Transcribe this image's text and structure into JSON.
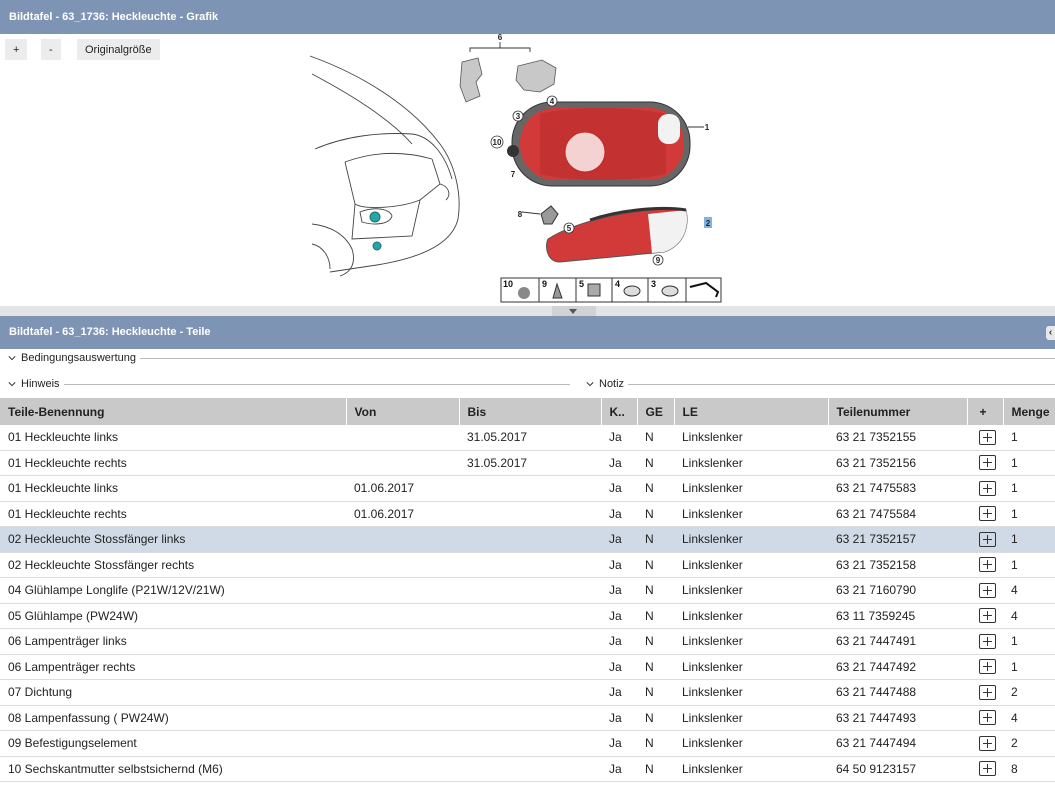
{
  "graphic_panel": {
    "title": "Bildtafel - 63_1736: Heckleuchte - Grafik",
    "zoom_in": "+",
    "zoom_out": "-",
    "original_size": "Originalgröße",
    "callouts": [
      "6",
      "4",
      "3",
      "1",
      "10",
      "7",
      "8",
      "5",
      "2",
      "9"
    ],
    "legend": [
      "10",
      "9",
      "5",
      "4",
      "3"
    ]
  },
  "parts_panel": {
    "title": "Bildtafel - 63_1736: Heckleuchte - Teile",
    "collapse_icon": "chevron-left-icon",
    "sections": {
      "bedingungsauswertung": "Bedingungsauswertung",
      "hinweis": "Hinweis",
      "notiz": "Notiz"
    },
    "columns": {
      "name": "Teile-Benennung",
      "von": "Von",
      "bis": "Bis",
      "k": "K..",
      "ge": "GE",
      "le": "LE",
      "teilenummer": "Teilenummer",
      "add": "+",
      "menge": "Menge"
    },
    "rows": [
      {
        "name": "01 Heckleuchte links",
        "von": "",
        "bis": "31.05.2017",
        "k": "Ja",
        "ge": "N",
        "le": "Linkslenker",
        "nr": "63 21 7352155",
        "menge": "1"
      },
      {
        "name": "01 Heckleuchte rechts",
        "von": "",
        "bis": "31.05.2017",
        "k": "Ja",
        "ge": "N",
        "le": "Linkslenker",
        "nr": "63 21 7352156",
        "menge": "1"
      },
      {
        "name": "01 Heckleuchte links",
        "von": "01.06.2017",
        "bis": "",
        "k": "Ja",
        "ge": "N",
        "le": "Linkslenker",
        "nr": "63 21 7475583",
        "menge": "1"
      },
      {
        "name": "01 Heckleuchte rechts",
        "von": "01.06.2017",
        "bis": "",
        "k": "Ja",
        "ge": "N",
        "le": "Linkslenker",
        "nr": "63 21 7475584",
        "menge": "1"
      },
      {
        "name": "02 Heckleuchte Stossfänger links",
        "von": "",
        "bis": "",
        "k": "Ja",
        "ge": "N",
        "le": "Linkslenker",
        "nr": "63 21 7352157",
        "menge": "1"
      },
      {
        "name": "02 Heckleuchte Stossfänger rechts",
        "von": "",
        "bis": "",
        "k": "Ja",
        "ge": "N",
        "le": "Linkslenker",
        "nr": "63 21 7352158",
        "menge": "1"
      },
      {
        "name": "04 Glühlampe Longlife (P21W/12V/21W)",
        "von": "",
        "bis": "",
        "k": "Ja",
        "ge": "N",
        "le": "Linkslenker",
        "nr": "63 21 7160790",
        "menge": "4"
      },
      {
        "name": "05 Glühlampe (PW24W)",
        "von": "",
        "bis": "",
        "k": "Ja",
        "ge": "N",
        "le": "Linkslenker",
        "nr": "63 11 7359245",
        "menge": "4"
      },
      {
        "name": "06 Lampenträger links",
        "von": "",
        "bis": "",
        "k": "Ja",
        "ge": "N",
        "le": "Linkslenker",
        "nr": "63 21 7447491",
        "menge": "1"
      },
      {
        "name": "06 Lampenträger rechts",
        "von": "",
        "bis": "",
        "k": "Ja",
        "ge": "N",
        "le": "Linkslenker",
        "nr": "63 21 7447492",
        "menge": "1"
      },
      {
        "name": "07 Dichtung",
        "von": "",
        "bis": "",
        "k": "Ja",
        "ge": "N",
        "le": "Linkslenker",
        "nr": "63 21 7447488",
        "menge": "2"
      },
      {
        "name": "08 Lampenfassung ( PW24W)",
        "von": "",
        "bis": "",
        "k": "Ja",
        "ge": "N",
        "le": "Linkslenker",
        "nr": "63 21 7447493",
        "menge": "4"
      },
      {
        "name": "09 Befestigungselement",
        "von": "",
        "bis": "",
        "k": "Ja",
        "ge": "N",
        "le": "Linkslenker",
        "nr": "63 21 7447494",
        "menge": "2"
      },
      {
        "name": "10 Sechskantmutter selbstsichernd (M6)",
        "von": "",
        "bis": "",
        "k": "Ja",
        "ge": "N",
        "le": "Linkslenker",
        "nr": "64 50 9123157",
        "menge": "8"
      }
    ],
    "selected_row": 4
  }
}
